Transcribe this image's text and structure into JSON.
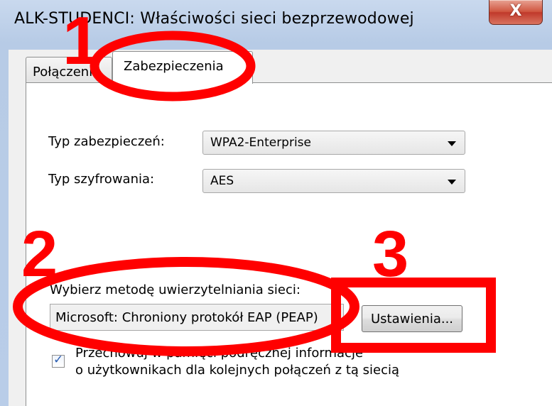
{
  "window": {
    "title": "ALK-STUDENCI: Właściwości sieci bezprzewodowej",
    "close_glyph": "X"
  },
  "tabs": [
    {
      "label": "Połączenie",
      "active": false
    },
    {
      "label": "Zabezpieczenia",
      "active": true
    }
  ],
  "security": {
    "security_type_label": "Typ zabezpieczeń:",
    "security_type_value": "WPA2-Enterprise",
    "encryption_type_label": "Typ szyfrowania:",
    "encryption_type_value": "AES",
    "auth_method_label": "Wybierz metodę uwierzytelniania sieci:",
    "auth_method_value": "Microsoft: Chroniony protokół EAP (PEAP)",
    "settings_button": "Ustawienia...",
    "remember_checked": true,
    "remember_line1": "Przechowuj w pamięci podręcznej informacje",
    "remember_line2": "o użytkownikach dla kolejnych połączeń z tą siecią"
  },
  "annotations": {
    "step1": "1",
    "step2": "2",
    "step3": "3",
    "color": "#ff0000"
  },
  "colors": {
    "accent": "#ff0000",
    "titlebar": "#c9d9ee",
    "close": "#c0392b"
  }
}
